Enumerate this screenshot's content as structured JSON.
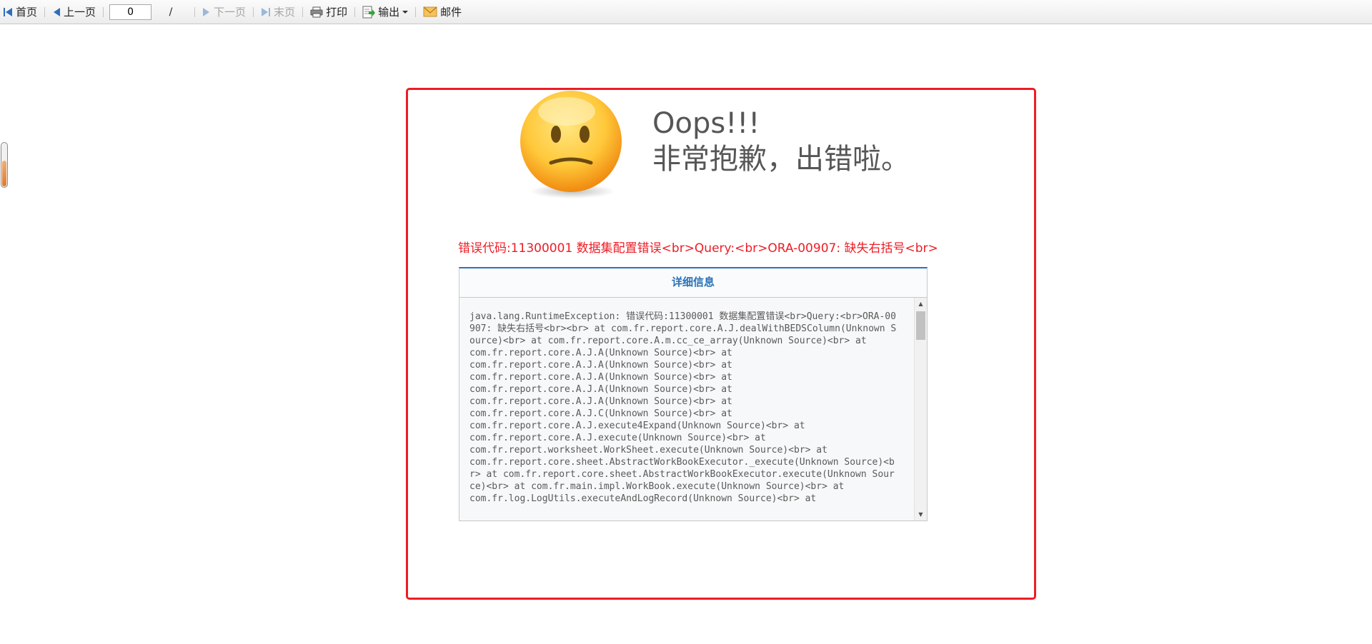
{
  "toolbar": {
    "first_label": "首页",
    "prev_label": "上一页",
    "page_value": "0",
    "separator": "/",
    "next_label": "下一页",
    "last_label": "末页",
    "print_label": "打印",
    "export_label": "输出",
    "mail_label": "邮件"
  },
  "error": {
    "title": "Oops!!!",
    "subtitle": "非常抱歉，出错啦。",
    "message": "错误代码:11300001 数据集配置错误<br>Query:<br>ORA-00907: 缺失右括号<br>",
    "detail_title": "详细信息",
    "trace": "java.lang.RuntimeException: 错误代码:11300001 数据集配置错误<br>Query:<br>ORA-00907: 缺失右括号<br><br> at com.fr.report.core.A.J.dealWithBEDSColumn(Unknown Source)<br> at com.fr.report.core.A.m.cc_ce_array(Unknown Source)<br> at\ncom.fr.report.core.A.J.A(Unknown Source)<br> at\ncom.fr.report.core.A.J.A(Unknown Source)<br> at\ncom.fr.report.core.A.J.A(Unknown Source)<br> at\ncom.fr.report.core.A.J.A(Unknown Source)<br> at\ncom.fr.report.core.A.J.A(Unknown Source)<br> at\ncom.fr.report.core.A.J.C(Unknown Source)<br> at\ncom.fr.report.core.A.J.execute4Expand(Unknown Source)<br> at\ncom.fr.report.core.A.J.execute(Unknown Source)<br> at\ncom.fr.report.worksheet.WorkSheet.execute(Unknown Source)<br> at\ncom.fr.report.core.sheet.AbstractWorkBookExecutor._execute(Unknown Source)<br> at com.fr.report.core.sheet.AbstractWorkBookExecutor.execute(Unknown Source)<br> at com.fr.main.impl.WorkBook.execute(Unknown Source)<br> at\ncom.fr.log.LogUtils.executeAndLogRecord(Unknown Source)<br> at"
  },
  "colors": {
    "error_red": "#ee1c25",
    "detail_blue": "#2b73b8",
    "heading_gray": "#565656"
  }
}
